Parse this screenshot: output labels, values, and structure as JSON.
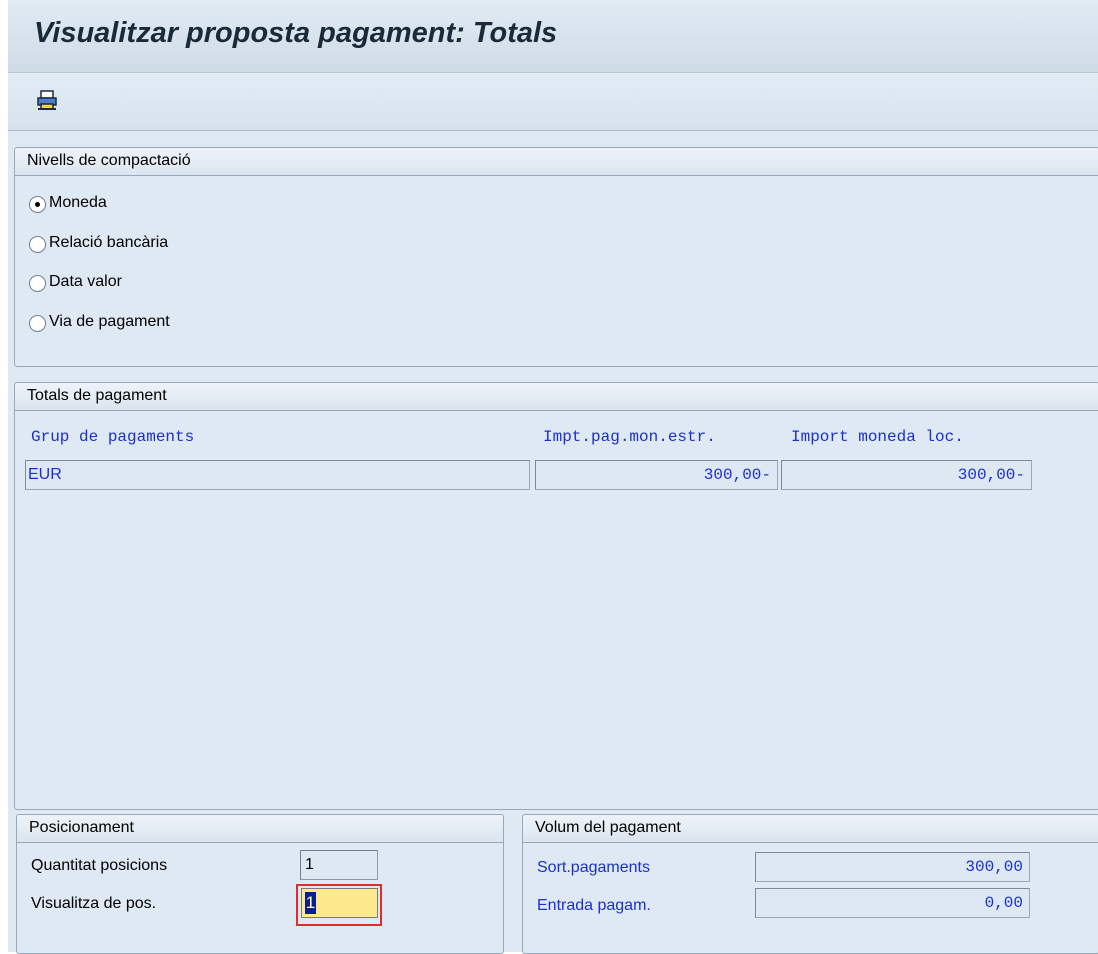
{
  "window": {
    "title": "Visualitzar proposta pagament: Totals"
  },
  "toolbar": {
    "print_icon": "printer-icon"
  },
  "compaction": {
    "title": "Nivells de compactació",
    "options": [
      {
        "label": "Moneda",
        "selected": true
      },
      {
        "label": "Relació bancària",
        "selected": false
      },
      {
        "label": "Data valor",
        "selected": false
      },
      {
        "label": "Via de pagament",
        "selected": false
      }
    ]
  },
  "totals": {
    "title": "Totals de pagament",
    "columns": [
      "Grup de pagaments",
      "Impt.pag.mon.estr.",
      "Import moneda loc."
    ],
    "rows": [
      {
        "group": "EUR",
        "foreign_amount": "300,00-",
        "local_amount": "300,00-"
      }
    ]
  },
  "positioning": {
    "title": "Posicionament",
    "quantity_label": "Quantitat posicions",
    "quantity_value": "1",
    "display_from_label": "Visualitza de pos.",
    "display_from_value": "1"
  },
  "volume": {
    "title": "Volum del pagament",
    "outgoing_label": "Sort.pagaments",
    "outgoing_value": "300,00",
    "incoming_label": "Entrada pagam.",
    "incoming_value": "0,00"
  },
  "colors": {
    "field_label_blue": "#1a2fd0",
    "background": "#dfe9f4",
    "focus_border": "#e22b2b",
    "active_input": "#ffe98f"
  }
}
